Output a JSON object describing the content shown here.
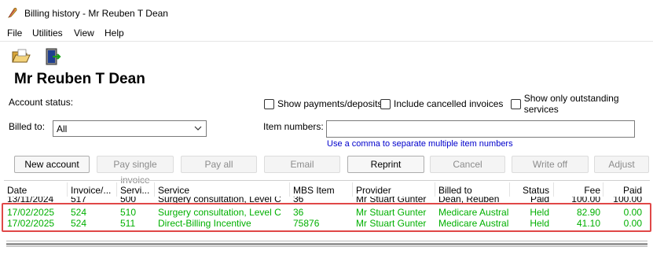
{
  "window": {
    "title": "Billing history - Mr Reuben T Dean"
  },
  "menu": [
    {
      "label": "File"
    },
    {
      "label": "Utilities"
    },
    {
      "label": "View"
    },
    {
      "label": "Help"
    }
  ],
  "toolbar": {
    "icons": [
      "folder-open-icon",
      "exit-door-icon"
    ]
  },
  "patient": {
    "name": "Mr Reuben T Dean"
  },
  "filters": {
    "account_status_label": "Account status:",
    "billed_to_label": "Billed to:",
    "billed_to_value": "All",
    "item_numbers_label": "Item numbers:",
    "item_numbers_value": "",
    "item_numbers_hint": "Use a comma to separate multiple item numbers",
    "checkboxes": [
      {
        "label": "Show payments/deposits",
        "checked": false
      },
      {
        "label": "Include cancelled invoices",
        "checked": false
      },
      {
        "label": "Show only outstanding services",
        "checked": false
      }
    ]
  },
  "buttons": [
    {
      "label": "New account",
      "enabled": true
    },
    {
      "label": "Pay single invoice",
      "enabled": false
    },
    {
      "label": "Pay all",
      "enabled": false
    },
    {
      "label": "Email",
      "enabled": false
    },
    {
      "label": "Reprint",
      "enabled": true
    },
    {
      "label": "Cancel",
      "enabled": false
    },
    {
      "label": "Write off",
      "enabled": false
    },
    {
      "label": "Adjust",
      "enabled": false
    }
  ],
  "table": {
    "columns": [
      "Date",
      "Invoice/...",
      "Servi...",
      "Service",
      "MBS Item",
      "Provider",
      "Billed to",
      "Status",
      "Fee",
      "Paid"
    ],
    "rows": [
      {
        "cells": [
          "13/11/2024",
          "517",
          "500",
          "Surgery consultation, Level C",
          "36",
          "Mr Stuart Gunter",
          "Dean, Reuben",
          "Paid",
          "100.00",
          "100.00"
        ],
        "color": "#000000",
        "partial": true
      },
      {
        "cells": [
          "17/02/2025",
          "524",
          "510",
          "Surgery consultation, Level C",
          "36",
          "Mr Stuart Gunter",
          "Medicare Australia",
          "Held",
          "82.90",
          "0.00"
        ],
        "color": "#00b000",
        "partial": false
      },
      {
        "cells": [
          "17/02/2025",
          "524",
          "511",
          "Direct-Billing Incentive",
          "75876",
          "Mr Stuart Gunter",
          "Medicare Australia",
          "Held",
          "41.10",
          "0.00"
        ],
        "color": "#00b000",
        "partial": false
      }
    ]
  },
  "colors": {
    "held_row": "#00b000",
    "highlight_border": "#e04848",
    "hint": "#0000cc"
  }
}
